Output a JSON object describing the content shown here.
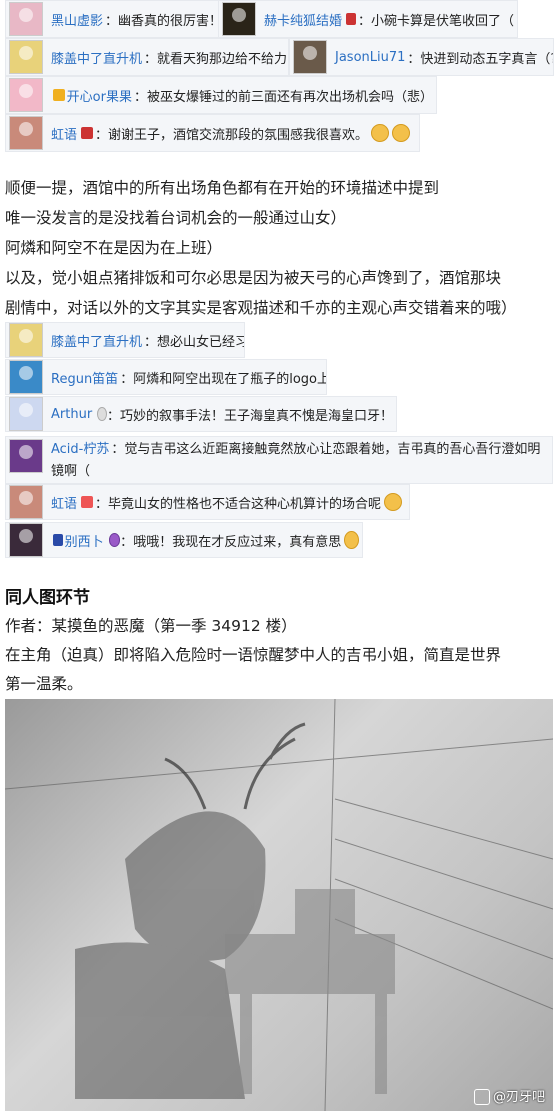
{
  "comments_top": [
    {
      "user": "黑山虚影",
      "text": "幽香真的很厉害！",
      "avatar_color": "#e8b8c6"
    },
    {
      "user": "赫卡纯狐结婚",
      "text": "小碗卡算是伏笔收回了（",
      "avatar_color": "#2a2418"
    },
    {
      "user": "膝盖中了直升机",
      "text": "就看天狗那边给不给力了",
      "avatar_color": "#e8d27a"
    },
    {
      "user": "JasonLiu71",
      "text": "快进到动态五字真言（?",
      "avatar_color": "#6a5a4a"
    },
    {
      "user": "开心or果果",
      "text": "被巫女爆锤过的前三面还有再次出场机会吗（悲）",
      "avatar_color": "#f2b8c8"
    },
    {
      "user": "虹语",
      "text": "谢谢王子，酒馆交流那段的氛围感我很喜欢。",
      "avatar_color": "#c98a7a"
    }
  ],
  "paragraph1": [
    "顺便一提，酒馆中的所有出场角色都有在开始的环境描述中提到",
    "唯一没发言的是没找着台词机会的一般通过山女）",
    "阿燐和阿空不在是因为在上班）",
    "以及，觉小姐点猪排饭和可尔必思是因为被天弓的心声馋到了，酒馆那块",
    "剧情中，对话以外的文字其实是客观描述和千亦的主观心声交错着来的哦）"
  ],
  "comments_mid": [
    {
      "user": "膝盖中了直升机",
      "text": "想必山女已经习惯了",
      "avatar_color": "#e8d27a"
    },
    {
      "user": "Regun笛笛",
      "text": "阿燐和阿空出现在了瓶子的logo上",
      "avatar_color": "#3a8ac8"
    },
    {
      "user": "Arthur",
      "text": "巧妙的叙事手法！王子海皇真不愧是海皇口牙！",
      "avatar_color": "#cdd8f0"
    },
    {
      "user": "Acid-柠苏",
      "text": "觉与吉弔这么近距离接触竟然放心让恋跟着她，吉弔真的吾心吾行澄如明镜啊（",
      "avatar_color": "#6a3a8a"
    },
    {
      "user": "虹语",
      "text": "毕竟山女的性格也不适合这种心机算计的场合呢",
      "avatar_color": "#c98a7a"
    },
    {
      "user": "别西卜",
      "text": "哦哦！我现在才反应过来，真有意思",
      "avatar_color": "#3a2a3a"
    }
  ],
  "section_title": "同人图环节",
  "author_line": "作者：某摸鱼的恶魔（第一季 34912 楼）",
  "caption_lines": [
    "在主角（迫真）即将陷入危险时一语惊醒梦中人的吉弔小姐，简直是世界",
    "第一温柔。"
  ],
  "watermark": "@刃牙吧"
}
